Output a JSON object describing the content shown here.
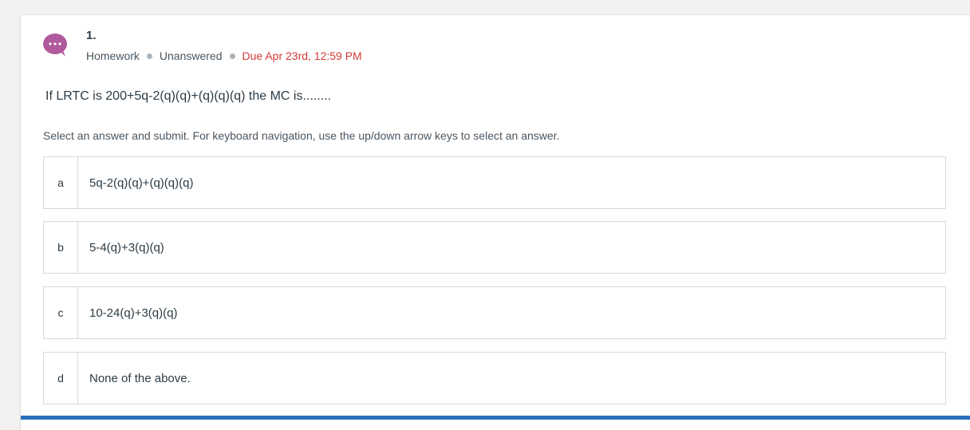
{
  "question": {
    "number": "1.",
    "type": "Homework",
    "status": "Unanswered",
    "due": "Due Apr 23rd, 12:59 PM",
    "prompt": "If LRTC is 200+5q-2(q)(q)+(q)(q)(q) the MC is........",
    "instructions": "Select an answer and submit. For keyboard navigation, use the up/down arrow keys to select an answer."
  },
  "options": [
    {
      "letter": "a",
      "text": "5q-2(q)(q)+(q)(q)(q)"
    },
    {
      "letter": "b",
      "text": "5-4(q)+3(q)(q)"
    },
    {
      "letter": "c",
      "text": "10-24(q)+3(q)(q)"
    },
    {
      "letter": "d",
      "text": "None of the above."
    }
  ],
  "icons": {
    "avatar": "chat-bubble-icon"
  },
  "colors": {
    "avatar": "#b05a9d",
    "due": "#d33a3a",
    "accent_bar": "#2a6ebb"
  }
}
